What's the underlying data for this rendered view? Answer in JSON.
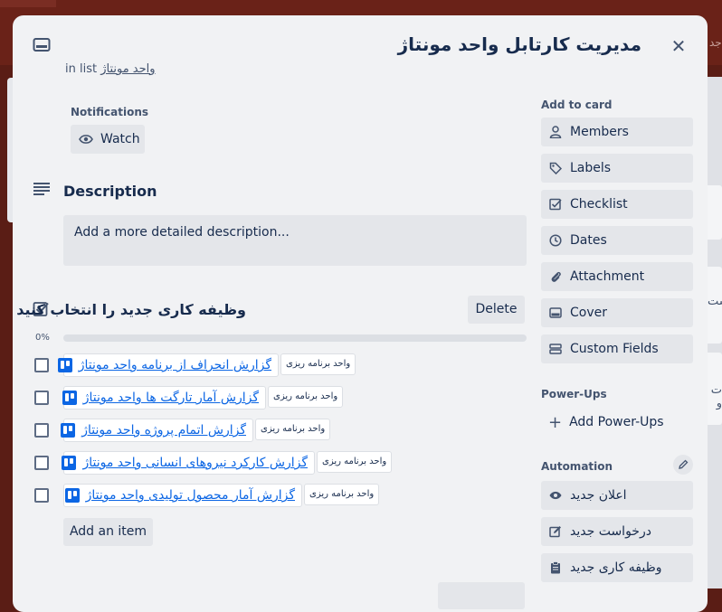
{
  "background": {
    "top_text": "جد",
    "right_texts": [
      "ست",
      "ت و"
    ]
  },
  "card": {
    "title": "مدیریت کارتابل واحد مونتاژ",
    "in_list_prefix": "in list",
    "list_name": "واحد مونتاژ",
    "close_symbol": "✕"
  },
  "notifications": {
    "label": "Notifications",
    "watch_label": "Watch"
  },
  "description": {
    "title": "Description",
    "placeholder": "Add a more detailed description..."
  },
  "checklist": {
    "title": "وظیفه کاری جدید را انتخاب کنید",
    "delete_label": "Delete",
    "progress_text": "0%",
    "progress_fraction": 0,
    "add_item_label": "Add an item",
    "items": [
      {
        "name": "گزارش انحراف از برنامه واحد مونتاژ",
        "tag": "واحد برنامه ریزی"
      },
      {
        "name": "گزارش آمار تارگت ها واحد مونتاژ",
        "tag": "واحد برنامه ریزی"
      },
      {
        "name": "گزارش اتمام پروژه واحد مونتاژ",
        "tag": "واحد برنامه ریزی"
      },
      {
        "name": "گزارش کارکرد نیروهای انسانی واحد مونتاژ",
        "tag": "واحد برنامه ریزی"
      },
      {
        "name": "گزارش آمار محصول تولیدی واحد مونتاژ",
        "tag": "واحد برنامه ریزی"
      }
    ]
  },
  "sidebar": {
    "add_to_card_label": "Add to card",
    "buttons": [
      {
        "label": "Members",
        "icon": "person-icon"
      },
      {
        "label": "Labels",
        "icon": "tag-icon"
      },
      {
        "label": "Checklist",
        "icon": "checkbox-icon"
      },
      {
        "label": "Dates",
        "icon": "clock-icon"
      },
      {
        "label": "Attachment",
        "icon": "paperclip-icon"
      },
      {
        "label": "Cover",
        "icon": "cover-icon"
      },
      {
        "label": "Custom Fields",
        "icon": "custom-fields-icon"
      }
    ],
    "powerups_label": "Power-Ups",
    "add_powerups_label": "Add Power-Ups",
    "automation_label": "Automation",
    "automation_buttons": [
      {
        "label": "اعلان جدید",
        "icon": "eye-icon"
      },
      {
        "label": "درخواست جدید",
        "icon": "edit-icon"
      },
      {
        "label": "وظیفه کاری جدید",
        "icon": "clipboard-icon"
      }
    ]
  }
}
